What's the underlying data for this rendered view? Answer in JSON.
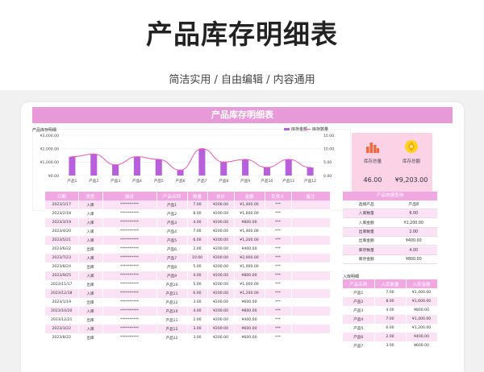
{
  "header": {
    "title": "产品库存明细表",
    "subtitle": "简洁实用 / 自由编辑 / 内容通用"
  },
  "sheet": {
    "banner": "产品库存明细表"
  },
  "chart_data": {
    "type": "bar",
    "title": "产品库存明细",
    "categories": [
      "产品1",
      "产品2",
      "产品3",
      "产品4",
      "产品5",
      "产品6",
      "产品7",
      "产品8",
      "产品9",
      "产品10",
      "产品11",
      "产品12"
    ],
    "series": [
      {
        "name": "库存金额",
        "type": "bar",
        "axis": "left",
        "values": [
          1400,
          1600,
          800,
          1400,
          1200,
          400,
          2000,
          1000,
          1200,
          600,
          1200,
          600
        ]
      },
      {
        "name": "库存数量",
        "type": "line",
        "axis": "right",
        "values": [
          7,
          8,
          4,
          7,
          6,
          2,
          10,
          5,
          6,
          3,
          6,
          3
        ]
      }
    ],
    "left_ticks": [
      "¥3,000.00",
      "¥2,000.00",
      "¥1,000.00",
      "¥0.00"
    ],
    "right_ticks": [
      "15.00",
      "10.00",
      "5.00",
      "0.00"
    ],
    "ylim_left": [
      0,
      3000
    ],
    "ylim_right": [
      0,
      15
    ],
    "colors": {
      "bar": "#b85fdc",
      "line": "#e85ab8"
    },
    "legend_position": "top-right",
    "grid": true
  },
  "kpis": [
    {
      "label": "库存总量",
      "value": "46.00",
      "bg": "#fbd2e6",
      "icon": "bar-chart-icon"
    },
    {
      "label": "库存总额",
      "value": "¥9,203.00",
      "bg": "#fbd2e6",
      "icon": "coin-icon"
    }
  ],
  "main_table": {
    "columns": [
      "日期",
      "类型",
      "描述",
      "产品名称",
      "数量",
      "单价",
      "金额",
      "负责人",
      "备注"
    ],
    "rows": [
      [
        "2023/1/17",
        "入库",
        "**********",
        "产品1",
        "7.00",
        "¥200.00",
        "¥1,400.00",
        "***",
        ""
      ],
      [
        "2023/2/18",
        "入库",
        "**********",
        "产品2",
        "8.00",
        "¥200.00",
        "¥1,600.00",
        "***",
        ""
      ],
      [
        "2023/3/19",
        "入库",
        "**********",
        "产品3",
        "4.00",
        "¥200.00",
        "¥800.00",
        "***",
        ""
      ],
      [
        "2023/4/20",
        "入库",
        "**********",
        "产品4",
        "7.00",
        "¥200.00",
        "¥1,400.00",
        "***",
        ""
      ],
      [
        "2023/5/21",
        "入库",
        "**********",
        "产品5",
        "6.00",
        "¥200.00",
        "¥1,200.00",
        "***",
        ""
      ],
      [
        "2023/6/22",
        "出库",
        "**********",
        "产品6",
        "2.00",
        "¥200.00",
        "¥400.00",
        "***",
        ""
      ],
      [
        "2023/7/23",
        "入库",
        "**********",
        "产品7",
        "10.00",
        "¥200.00",
        "¥2,000.00",
        "***",
        ""
      ],
      [
        "2023/8/24",
        "出库",
        "**********",
        "产品8",
        "5.00",
        "¥200.00",
        "¥1,000.00",
        "***",
        ""
      ],
      [
        "2023/9/25",
        "入库",
        "**********",
        "产品9",
        "4.00",
        "¥200.00",
        "¥800.00",
        "***",
        ""
      ],
      [
        "2023/11/17",
        "出库",
        "**********",
        "产品10",
        "5.00",
        "¥200.00",
        "¥1,000.00",
        "***",
        ""
      ],
      [
        "2023/12/18",
        "入库",
        "**********",
        "产品11",
        "6.00",
        "¥200.00",
        "¥1,200.00",
        "***",
        ""
      ],
      [
        "2023/1/19",
        "出库",
        "**********",
        "产品12",
        "3.00",
        "¥200.00",
        "¥600.00",
        "***",
        ""
      ],
      [
        "2023/10/20",
        "入库",
        "**********",
        "产品10",
        "4.00",
        "¥200.00",
        "¥800.00",
        "***",
        ""
      ],
      [
        "2023/12/21",
        "出库",
        "**********",
        "产品11",
        "2.00",
        "¥200.00",
        "¥400.00",
        "***",
        ""
      ],
      [
        "2023/3/22",
        "入库",
        "**********",
        "产品12",
        "3.00",
        "¥200.00",
        "¥600.00",
        "***",
        ""
      ],
      [
        "2023/8/22",
        "出库",
        "**********",
        "产品12",
        "3.00",
        "¥200.00",
        "¥600.00",
        "***",
        ""
      ]
    ]
  },
  "quick_lookup": {
    "title": "产品快捷查询",
    "rows": [
      [
        "选择产品",
        "产品8"
      ],
      [
        "入库数量",
        "6.00"
      ],
      [
        "入库金额",
        "¥1,200.00"
      ],
      [
        "出库数量",
        "2.00"
      ],
      [
        "出库金额",
        "¥400.00"
      ],
      [
        "库存数量",
        "4.00"
      ],
      [
        "库存金额",
        "¥800.00"
      ]
    ]
  },
  "inbound_detail": {
    "title": "入库明细",
    "columns": [
      "产品名称",
      "入库数量",
      "入库金额"
    ],
    "rows": [
      [
        "产品1",
        "7.00",
        "¥1,400.00"
      ],
      [
        "产品2",
        "8.00",
        "¥1,600.00"
      ],
      [
        "产品3",
        "4.00",
        "¥800.00"
      ],
      [
        "产品4",
        "7.00",
        "¥1,400.00"
      ],
      [
        "产品5",
        "6.00",
        "¥1,200.00"
      ],
      [
        "产品6",
        "2.00",
        "¥400.00"
      ],
      [
        "产品7",
        "3.00",
        "¥600.00"
      ]
    ]
  }
}
